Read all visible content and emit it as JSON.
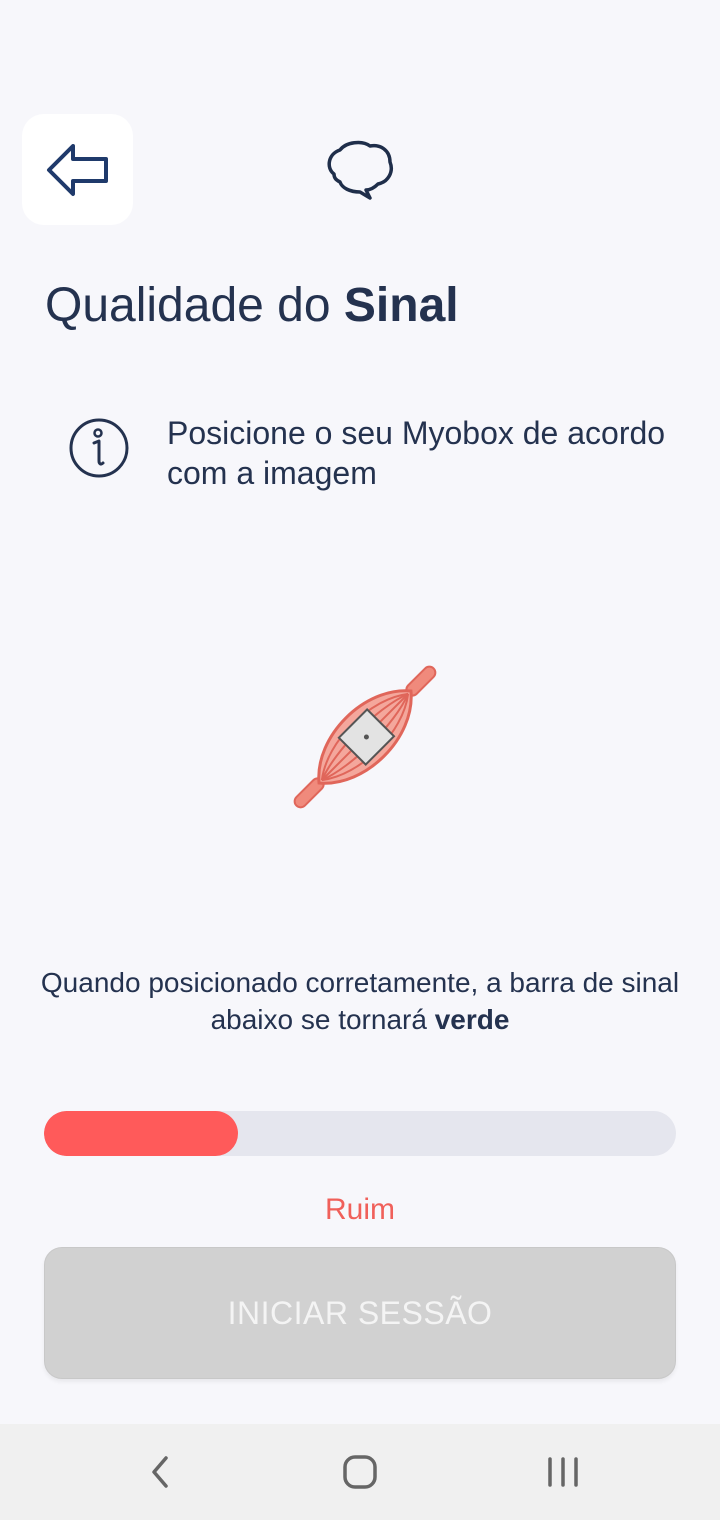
{
  "header": {
    "back_icon": "arrow-left-icon",
    "logo_icon": "brain-outline-icon"
  },
  "page": {
    "title_regular": "Qualidade do ",
    "title_bold": "Sinal"
  },
  "info": {
    "icon": "info-icon",
    "text": "Posicione o seu Myobox de acordo com a imagem"
  },
  "illustration": {
    "icon": "muscle-with-sensor-icon"
  },
  "instruction": {
    "text_before": "Quando posicionado corretamente, a barra de sinal abaixo se tornará ",
    "text_bold": "verde"
  },
  "signal": {
    "level": 0.307,
    "label": "Ruim",
    "color": "#ff5a5a"
  },
  "start_button": {
    "label": "INICIAR SESSÃO",
    "enabled": false
  },
  "navbar": {
    "back_icon": "nav-back-icon",
    "home_icon": "nav-home-icon",
    "recents_icon": "nav-recents-icon"
  }
}
